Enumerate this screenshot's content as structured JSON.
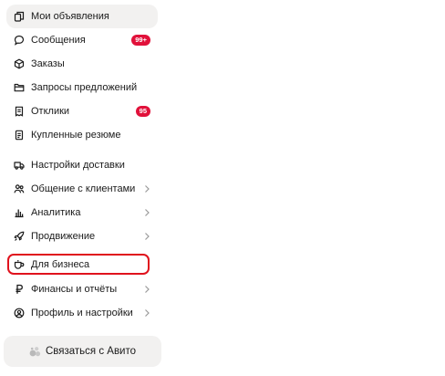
{
  "menu": {
    "items": [
      {
        "id": "my-ads",
        "label": "Мои объявления",
        "icon": "copy-icon",
        "active": true
      },
      {
        "id": "messages",
        "label": "Сообщения",
        "icon": "chat-bubble-icon",
        "badge": "99+"
      },
      {
        "id": "orders",
        "label": "Заказы",
        "icon": "box-icon"
      },
      {
        "id": "offer-requests",
        "label": "Запросы предложений",
        "icon": "folder-icon"
      },
      {
        "id": "responses",
        "label": "Отклики",
        "icon": "document-icon",
        "badge": "95"
      },
      {
        "id": "purchased-resumes",
        "label": "Купленные резюме",
        "icon": "resume-icon"
      },
      {
        "id": "delivery-settings",
        "label": "Настройки доставки",
        "icon": "truck-icon"
      },
      {
        "id": "client-communication",
        "label": "Общение с клиентами",
        "icon": "people-icon",
        "chevron": true
      },
      {
        "id": "analytics",
        "label": "Аналитика",
        "icon": "bar-chart-icon",
        "chevron": true
      },
      {
        "id": "promotion",
        "label": "Продвижение",
        "icon": "rocket-icon",
        "chevron": true
      },
      {
        "id": "for-business",
        "label": "Для бизнеса",
        "icon": "business-icon",
        "highlighted": true
      },
      {
        "id": "finance",
        "label": "Финансы и отчёты",
        "icon": "ruble-icon",
        "chevron": true
      },
      {
        "id": "profile",
        "label": "Профиль и настройки",
        "icon": "user-circle-icon",
        "chevron": true
      }
    ]
  },
  "contact": {
    "label": "Связаться с Авито",
    "icon": "avito-icon"
  },
  "colors": {
    "badge": "#e1113a",
    "highlight": "#e0121d",
    "active_bg": "#f2f1f0"
  }
}
